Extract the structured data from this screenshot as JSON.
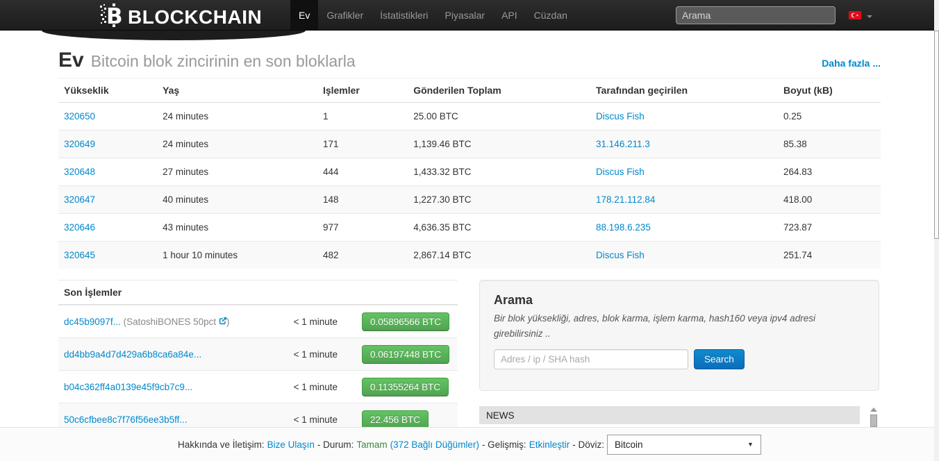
{
  "navbar": {
    "logo_text": "BLOCKCHAIN",
    "menu": [
      {
        "label": "Ev",
        "active": true
      },
      {
        "label": "Grafikler",
        "active": false
      },
      {
        "label": "İstatistikleri",
        "active": false
      },
      {
        "label": "Piyasalar",
        "active": false
      },
      {
        "label": "API",
        "active": false
      },
      {
        "label": "Cüzdan",
        "active": false
      }
    ],
    "search_placeholder": "Arama",
    "language_flag": "turkish-flag"
  },
  "page_header": {
    "title": "Ev",
    "subtitle": "Bitcoin blok zincirinin en son bloklarla",
    "more_link": "Daha fazla ..."
  },
  "blocks_table": {
    "columns": [
      "Yükseklik",
      "Yaş",
      "Işlemler",
      "Gönderilen Toplam",
      "Tarafından geçirilen",
      "Boyut (kB)"
    ],
    "rows": [
      {
        "height": "320650",
        "age": "24 minutes",
        "transactions": "1",
        "total_sent": "25.00 BTC",
        "relayed_by": "Discus Fish",
        "size": "0.25"
      },
      {
        "height": "320649",
        "age": "24 minutes",
        "transactions": "171",
        "total_sent": "1,139.46 BTC",
        "relayed_by": "31.146.211.3",
        "size": "85.38"
      },
      {
        "height": "320648",
        "age": "27 minutes",
        "transactions": "444",
        "total_sent": "1,433.32 BTC",
        "relayed_by": "Discus Fish",
        "size": "264.83"
      },
      {
        "height": "320647",
        "age": "40 minutes",
        "transactions": "148",
        "total_sent": "1,227.30 BTC",
        "relayed_by": "178.21.112.84",
        "size": "418.00"
      },
      {
        "height": "320646",
        "age": "43 minutes",
        "transactions": "977",
        "total_sent": "4,636.35 BTC",
        "relayed_by": "88.198.6.235",
        "size": "723.87"
      },
      {
        "height": "320645",
        "age": "1 hour 10 minutes",
        "transactions": "482",
        "total_sent": "2,867.14 BTC",
        "relayed_by": "Discus Fish",
        "size": "251.74"
      }
    ]
  },
  "transactions": {
    "title": "Son İşlemler",
    "rows": [
      {
        "hash": "dc45b9097f...",
        "tag_prefix": "(SatoshiBONES 50pct",
        "tag_suffix": ")",
        "age": "< 1 minute",
        "amount": "0.05896566 BTC"
      },
      {
        "hash": "dd4bb9a4d7d429a6b8ca6a84e...",
        "age": "< 1 minute",
        "amount": "0.06197448 BTC"
      },
      {
        "hash": "b04c362ff4a0139e45f9cb7c9...",
        "age": "< 1 minute",
        "amount": "0.11355264 BTC"
      },
      {
        "hash": "50c6cfbee8c7f76f56ee3b5ff...",
        "age": "< 1 minute",
        "amount": "22.456 BTC"
      }
    ]
  },
  "search_panel": {
    "title": "Arama",
    "description": "Bir blok yüksekliği, adres, blok karma, işlem karma, hash160 veya ipv4 adresi girebilirsiniz ..",
    "input_placeholder": "Adres / ip / SHA hash",
    "button_label": "Search"
  },
  "news_panel": {
    "title": "NEWS"
  },
  "footer": {
    "about_label": "Hakkında ve İletişim:",
    "contact_link": "Bize Ulaşın",
    "status_label": "- Durum:",
    "status_value": "Tamam",
    "nodes_link": "(372 Bağlı Düğümler)",
    "advanced_label": "- Gelişmiş:",
    "enable_link": "Etkinleştir",
    "currency_label": "- Döviz:",
    "currency_value": "Bitcoin"
  },
  "colors": {
    "link_blue": "#0088cc",
    "button_green": "#5bb75b",
    "button_blue": "#0c7bc4",
    "status_ok_green": "#3c863c",
    "navbar_dark": "#1d1d1d",
    "flag_red": "#e30a17"
  }
}
